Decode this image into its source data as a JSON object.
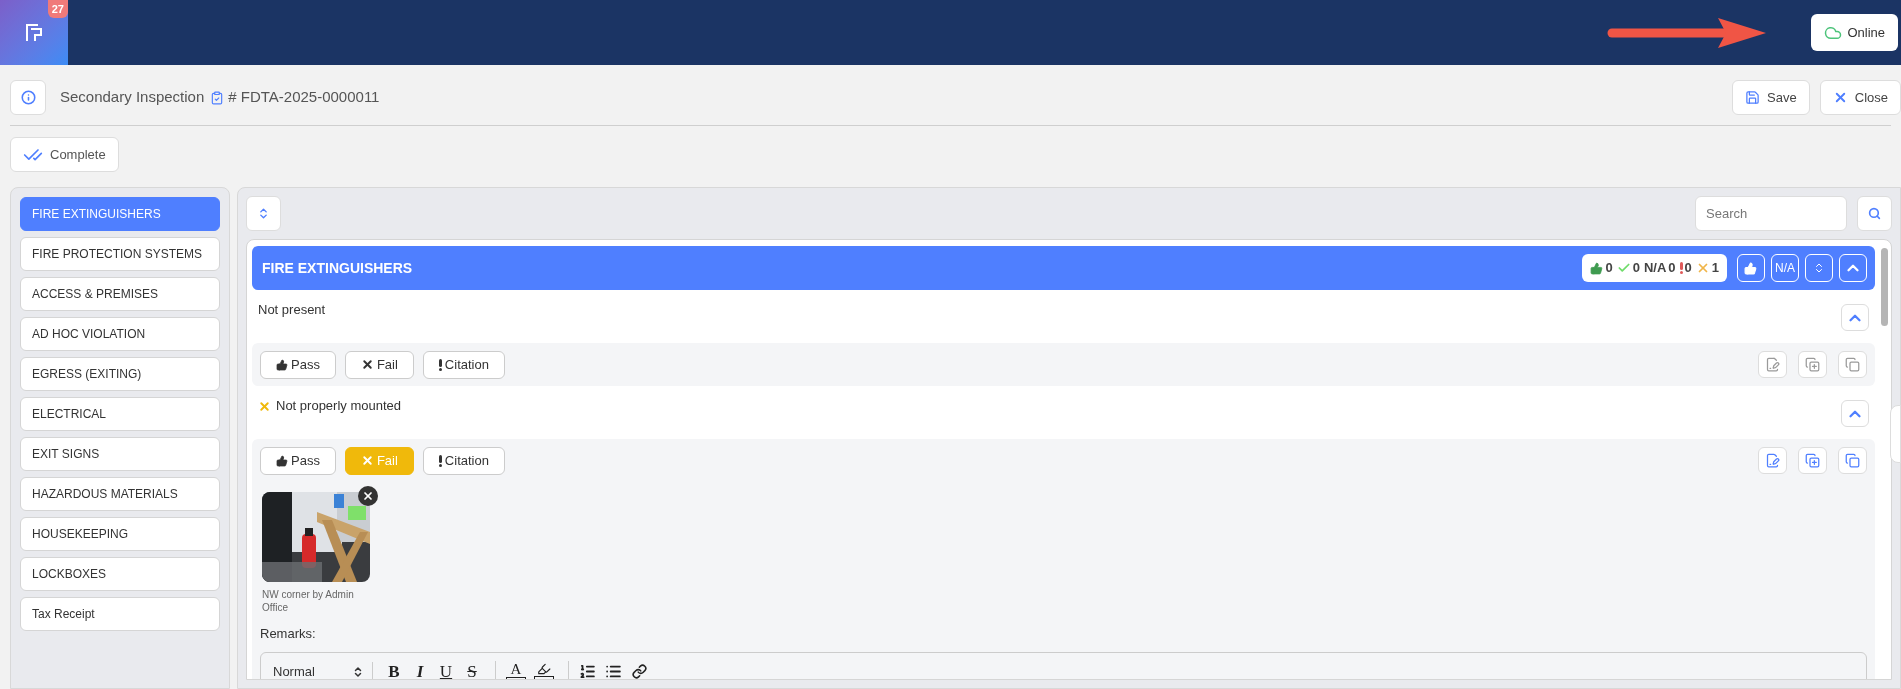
{
  "app_bar": {
    "badge": "27",
    "status": "Online"
  },
  "page": {
    "title": "Secondary Inspection",
    "reference": "# FDTA-2025-0000011",
    "buttons": [
      {
        "kind": "save",
        "label": "Save"
      },
      {
        "kind": "close",
        "label": "Close"
      }
    ],
    "complete_label": "Complete"
  },
  "sidebar": {
    "items": [
      {
        "label": "FIRE EXTINGUISHERS",
        "selected": true
      },
      {
        "label": "FIRE PROTECTION SYSTEMS",
        "selected": false
      },
      {
        "label": "ACCESS & PREMISES",
        "selected": false
      },
      {
        "label": "AD HOC VIOLATION",
        "selected": false
      },
      {
        "label": "EGRESS (EXITING)",
        "selected": false
      },
      {
        "label": "ELECTRICAL",
        "selected": false
      },
      {
        "label": "EXIT SIGNS",
        "selected": false
      },
      {
        "label": "HAZARDOUS MATERIALS",
        "selected": false
      },
      {
        "label": "HOUSEKEEPING",
        "selected": false
      },
      {
        "label": "LOCKBOXES",
        "selected": false
      },
      {
        "label": "Tax Receipt",
        "selected": false
      }
    ]
  },
  "search": {
    "placeholder": "Search"
  },
  "section": {
    "title": "FIRE EXTINGUISHERS",
    "counts": [
      {
        "kind": "pass",
        "value": "0"
      },
      {
        "kind": "ok",
        "value": "0"
      },
      {
        "kind": "na",
        "label": "N/A",
        "value": "0"
      },
      {
        "kind": "citation",
        "value": "0"
      },
      {
        "kind": "fail",
        "value": "1"
      }
    ],
    "na_label": "N/A",
    "items": [
      {
        "text": "Not present",
        "failed": false,
        "tools_active": false,
        "actions": [
          {
            "kind": "pass",
            "label": "Pass",
            "selected": false
          },
          {
            "kind": "fail",
            "label": "Fail",
            "selected": false
          },
          {
            "kind": "citation",
            "label": "Citation",
            "selected": false
          }
        ]
      },
      {
        "text": "Not properly mounted",
        "failed": true,
        "tools_active": true,
        "actions": [
          {
            "kind": "pass",
            "label": "Pass",
            "selected": false
          },
          {
            "kind": "fail",
            "label": "Fail",
            "selected": true
          },
          {
            "kind": "citation",
            "label": "Citation",
            "selected": false
          }
        ],
        "photos": [
          {
            "kind": "picture",
            "caption": "NW corner by Admin Office"
          }
        ],
        "remarks": {
          "label": "Remarks:",
          "format": "Normal",
          "tools": [
            {
              "kind": "bold",
              "label": "B"
            },
            {
              "kind": "italic",
              "label": "I"
            },
            {
              "kind": "underline",
              "label": "U"
            },
            {
              "kind": "strike",
              "label": "S"
            },
            {
              "kind": "color",
              "label": "A"
            },
            {
              "kind": "highlight"
            },
            {
              "kind": "ordered-list"
            },
            {
              "kind": "bullet-list"
            },
            {
              "kind": "link"
            }
          ]
        }
      }
    ]
  }
}
